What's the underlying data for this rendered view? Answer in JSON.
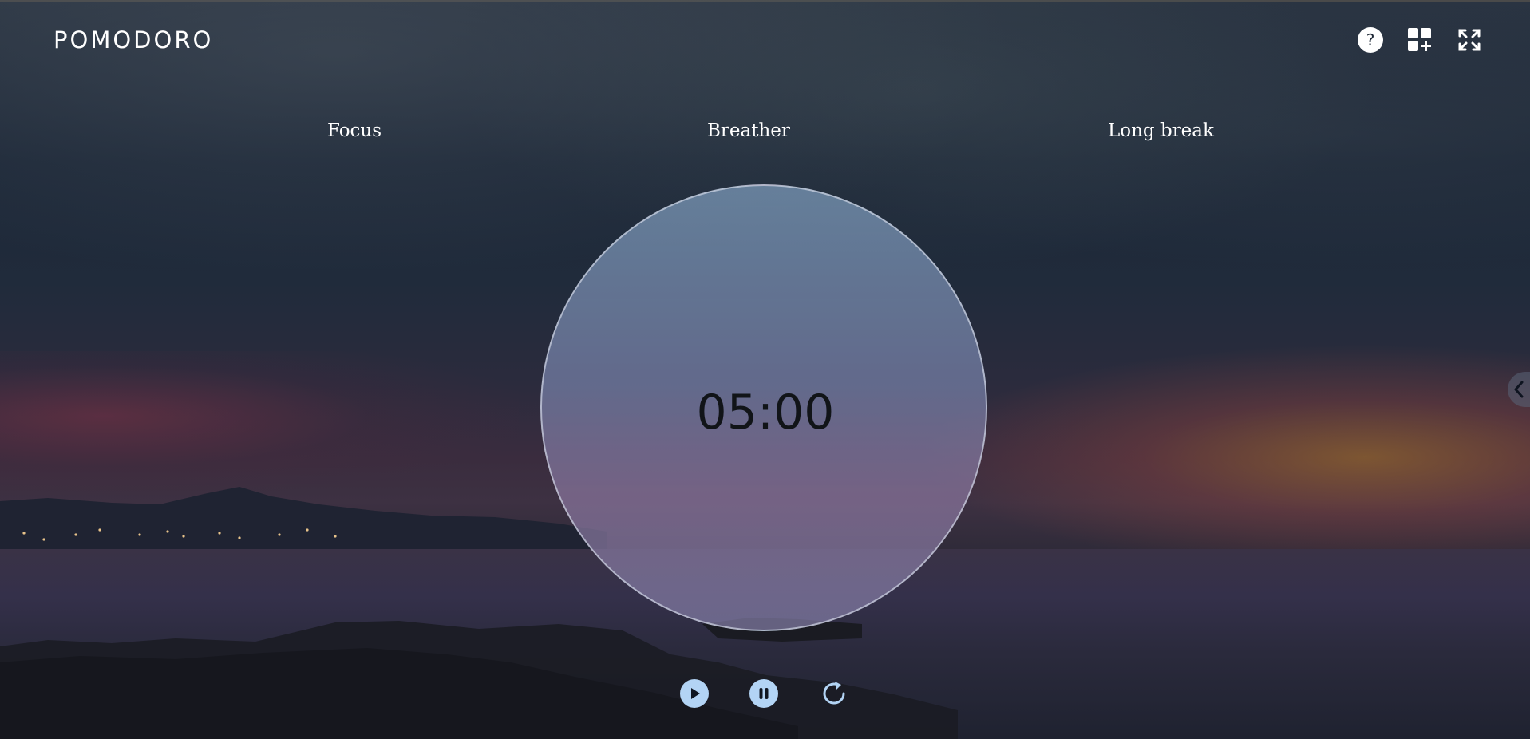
{
  "app": {
    "logo": "POMODORO"
  },
  "header": {
    "icons": [
      "help-icon",
      "add-widget-icon",
      "fullscreen-icon"
    ]
  },
  "tabs": [
    {
      "label": "Focus"
    },
    {
      "label": "Breather"
    },
    {
      "label": "Long break"
    }
  ],
  "timer": {
    "display": "05:00"
  },
  "controls": {
    "icons": [
      "play-icon",
      "pause-icon",
      "reset-icon"
    ]
  },
  "colors": {
    "control_fill": "#b3d4f5",
    "text": "#ffffff"
  }
}
